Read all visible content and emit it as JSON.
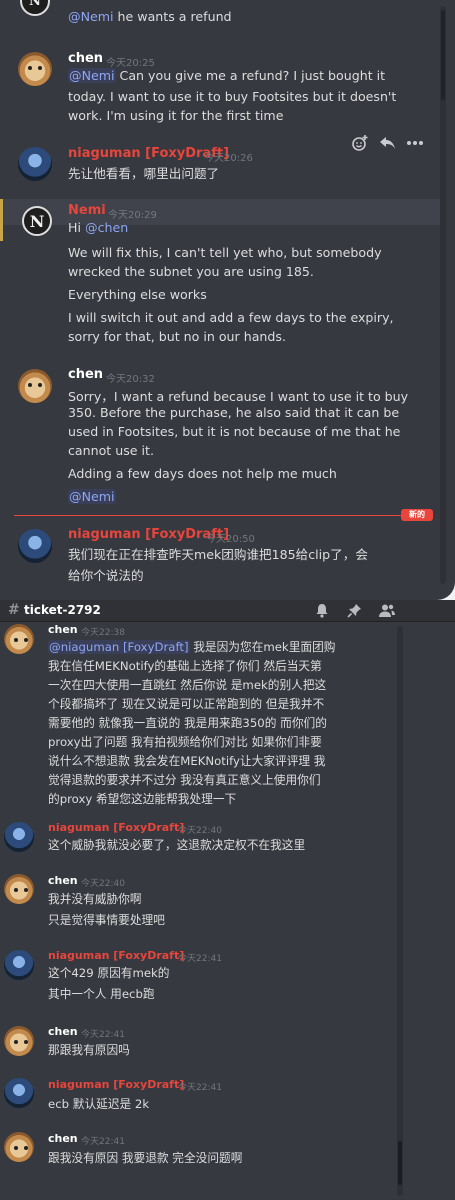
{
  "top_panel": {
    "reply_preview": {
      "mention": "@Nemi",
      "text": "he wants a refund"
    },
    "messages": [
      {
        "author": "chen",
        "time": "今天20:25",
        "lines": [
          {
            "mention": "@Nemi",
            "text": "Can you give me a refund? I just bought it"
          },
          {
            "text": "today. I want to use it to buy Footsites but it doesn't"
          },
          {
            "text": "work. I'm using it for the first time"
          }
        ]
      },
      {
        "author": "niaguman [FoxyDraft]",
        "time": "今天20:26",
        "lines": [
          {
            "text": "先让他看看，哪里出问题了"
          }
        ]
      },
      {
        "author": "Nemi",
        "time": "今天20:29",
        "lines": [
          {
            "text": "Hi ",
            "mention": "@chen"
          },
          {
            "text": "We will fix this, I can't tell yet who, but somebody"
          },
          {
            "text": "wrecked the subnet you are using 185."
          },
          {
            "text": "Everything else works"
          },
          {
            "text": "I will switch it out and add a few days to the expiry,"
          },
          {
            "text": "sorry for that, but no in our hands."
          }
        ]
      },
      {
        "author": "chen",
        "time": "今天20:32",
        "lines": [
          {
            "text": "Sorry，I want a refund because I want to use it to buy"
          },
          {
            "text": "350. Before the purchase, he also said that it can be"
          },
          {
            "text": "used in Footsites, but it is not because of me that he"
          },
          {
            "text": "cannot use it."
          },
          {
            "text": "Adding a few days does not help me much"
          },
          {
            "mention": "@Nemi"
          }
        ]
      },
      {
        "author": "niaguman [FoxyDraft]",
        "time": "今天20:50",
        "lines": [
          {
            "text": "我们现在正在排查昨天mek团购谁把185给clip了，会"
          },
          {
            "text": "给你个说法的"
          }
        ]
      }
    ],
    "new_badge": "新的",
    "hover_actions": [
      "add-reaction",
      "reply",
      "more"
    ]
  },
  "bottom_panel": {
    "channel": "ticket-2792",
    "header_icons": [
      "bell-icon",
      "pin-icon",
      "members-icon"
    ],
    "messages": [
      {
        "author": "chen",
        "time": "今天22:38",
        "lines": [
          {
            "mention": "@niaguman [FoxyDraft]",
            "text": " 我是因为您在mek里面团购"
          },
          {
            "text": "我在信任MEKNotify的基础上选择了你们 然后当天第"
          },
          {
            "text": "一次在四大使用一直跳红  然后你说 是mek的别人把这"
          },
          {
            "text": "个段都搞坏了 现在又说是可以正常跑到的 但是我并不"
          },
          {
            "text": "需要他的 就像我一直说的 我是用来跑350的 而你们的"
          },
          {
            "text": "proxy出了问题 我有拍视频给你们对比 如果你们非要"
          },
          {
            "text": "说什么不想退款 我会发在MEKNotify让大家评评理 我"
          },
          {
            "text": "觉得退款的要求并不过分 我没有真正意义上使用你们"
          },
          {
            "text": "的proxy 希望您这边能帮我处理一下"
          }
        ]
      },
      {
        "author": "niaguman [FoxyDraft]",
        "time": "今天22:40",
        "lines": [
          {
            "text": "这个威胁我就没必要了，这退款决定权不在我这里"
          }
        ]
      },
      {
        "author": "chen",
        "time": "今天22:40",
        "lines": [
          {
            "text": "我并没有威胁你啊"
          },
          {
            "text": "只是觉得事情要处理吧"
          }
        ]
      },
      {
        "author": "niaguman [FoxyDraft]",
        "time": "今天22:41",
        "lines": [
          {
            "text": "这个429 原因有mek的"
          },
          {
            "text": "其中一个人 用ecb跑"
          }
        ]
      },
      {
        "author": "chen",
        "time": "今天22:41",
        "lines": [
          {
            "text": "那跟我有原因吗"
          }
        ]
      },
      {
        "author": "niaguman [FoxyDraft]",
        "time": "今天22:41",
        "lines": [
          {
            "text": "ecb 默认延迟是 2k"
          }
        ]
      },
      {
        "author": "chen",
        "time": "今天22:41",
        "lines": [
          {
            "text": "跟我没有原因 我要退款 完全没问题啊"
          }
        ]
      }
    ]
  }
}
